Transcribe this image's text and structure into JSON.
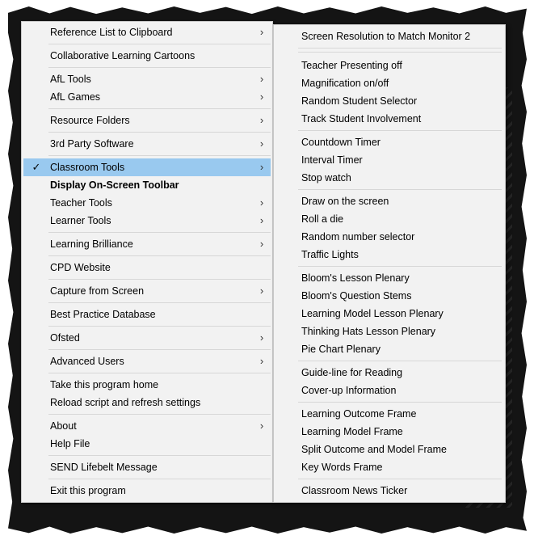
{
  "menu": {
    "items": [
      {
        "label": "Reference List to Clipboard",
        "arrow": "›"
      },
      {
        "label": "Collaborative Learning Cartoons"
      },
      {
        "label": "AfL Tools",
        "arrow": "›"
      },
      {
        "label": "AfL Games",
        "arrow": "›"
      },
      {
        "label": "Resource Folders",
        "arrow": "›"
      },
      {
        "label": "3rd Party Software",
        "arrow": "›"
      },
      {
        "label": "Classroom Tools",
        "arrow": "›",
        "check": "✓"
      },
      {
        "label": "Display On-Screen Toolbar"
      },
      {
        "label": "Teacher Tools",
        "arrow": "›"
      },
      {
        "label": "Learner Tools",
        "arrow": "›"
      },
      {
        "label": "Learning Brilliance",
        "arrow": "›"
      },
      {
        "label": "CPD Website"
      },
      {
        "label": "Capture from Screen",
        "arrow": "›"
      },
      {
        "label": "Best Practice Database"
      },
      {
        "label": "Ofsted",
        "arrow": "›"
      },
      {
        "label": "Advanced Users",
        "arrow": "›"
      },
      {
        "label": "Take this program home"
      },
      {
        "label": "Reload script and refresh settings"
      },
      {
        "label": "About",
        "arrow": "›"
      },
      {
        "label": "Help File"
      },
      {
        "label": "SEND Lifebelt Message"
      },
      {
        "label": "Exit this program"
      }
    ]
  },
  "submenu": {
    "items": [
      {
        "label": "Screen Resolution to Match Monitor 2"
      },
      {
        "label": "Teacher Presenting off"
      },
      {
        "label": "Magnification on/off"
      },
      {
        "label": "Random Student Selector"
      },
      {
        "label": "Track Student Involvement"
      },
      {
        "label": "Countdown Timer"
      },
      {
        "label": "Interval Timer"
      },
      {
        "label": "Stop watch"
      },
      {
        "label": "Draw on the screen"
      },
      {
        "label": "Roll a die"
      },
      {
        "label": "Random number selector"
      },
      {
        "label": "Traffic Lights"
      },
      {
        "label": "Bloom's Lesson Plenary"
      },
      {
        "label": "Bloom's Question Stems"
      },
      {
        "label": "Learning Model Lesson Plenary"
      },
      {
        "label": "Thinking Hats Lesson Plenary"
      },
      {
        "label": "Pie Chart Plenary"
      },
      {
        "label": "Guide-line for Reading"
      },
      {
        "label": "Cover-up Information"
      },
      {
        "label": "Learning Outcome Frame"
      },
      {
        "label": "Learning Model Frame"
      },
      {
        "label": "Split Outcome and Model Frame"
      },
      {
        "label": "Key Words Frame"
      },
      {
        "label": "Classroom News Ticker"
      }
    ]
  },
  "colors": {
    "menu_bg": "#f2f2f2",
    "highlight": "#99c9ef",
    "separator": "#d7d7d7"
  }
}
